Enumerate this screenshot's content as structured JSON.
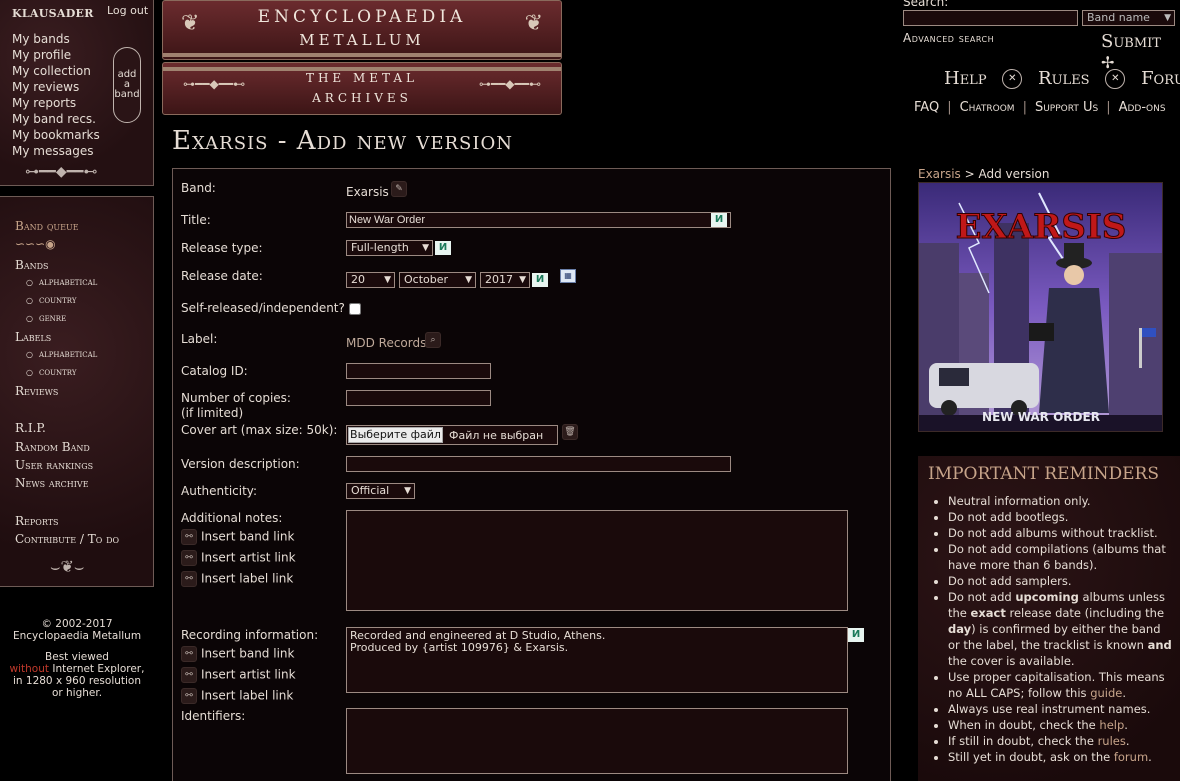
{
  "user": {
    "name": "KLAUSADER",
    "logout": "Log out"
  },
  "user_menu": [
    "My bands",
    "My profile",
    "My collection",
    "My reviews",
    "My reports",
    "My band recs.",
    "My bookmarks",
    "My messages"
  ],
  "add_band": {
    "l1": "add",
    "l2": "a",
    "l3": "band"
  },
  "nav": {
    "band_queue": "Band queue",
    "bands": "Bands",
    "bands_sub": [
      "alphabetical",
      "country",
      "genre"
    ],
    "labels": "Labels",
    "labels_sub": [
      "alphabetical",
      "country"
    ],
    "reviews": "Reviews",
    "rip": "R.I.P.",
    "random_band": "Random Band",
    "user_rankings": "User rankings",
    "news_archive": "News archive",
    "reports": "Reports",
    "contribute": "Contribute / To do"
  },
  "footer": {
    "copyright": "© 2002-2017",
    "site": "Encyclopaedia Metallum",
    "best1": "Best viewed",
    "without": "without",
    "best2": " Internet Explorer,",
    "best3": "in 1280 x 960 resolution",
    "best4": "or higher."
  },
  "logo": {
    "line1": "ENCYCLOPAEDIA",
    "line2": "METALLUM",
    "line3": "THE   METAL",
    "line4": "ARCHIVES"
  },
  "search": {
    "label": "Search:",
    "type": "Band name",
    "advanced": "Advanced search",
    "submit": "Submit"
  },
  "top_links": {
    "help": "Help",
    "rules": "Rules",
    "forum": "Forum",
    "faq": "FAQ",
    "chatroom": "Chatroom",
    "support": "Support Us",
    "addons": "Add-ons"
  },
  "page_title": "Exarsis - Add new version",
  "form": {
    "band_label": "Band:",
    "band_value": "Exarsis",
    "title_label": "Title:",
    "title_value": "New War Order",
    "type_label": "Release type:",
    "type_value": "Full-length",
    "date_label": "Release date:",
    "date_day": "20",
    "date_month": "October",
    "date_year": "2017",
    "self_label": "Self-released/independent?",
    "label_label": "Label:",
    "label_value": "MDD Records",
    "catalog_label": "Catalog ID:",
    "copies_label": "Number of copies:",
    "copies_sub": "(if limited)",
    "cover_label": "Cover art (max size: 50k):",
    "file_button": "Выберите файл",
    "file_status": "Файл не выбран",
    "version_label": "Version description:",
    "auth_label": "Authenticity:",
    "auth_value": "Official",
    "notes_label": "Additional notes:",
    "insert_band": "Insert band link",
    "insert_artist": "Insert artist link",
    "insert_label": "Insert label link",
    "recording_label": "Recording information:",
    "recording_value": "Recorded and engineered at D Studio, Athens.\nProduced by {artist 109976} & Exarsis.",
    "identifiers_label": "Identifiers:"
  },
  "crumb": {
    "band": "Exarsis",
    "sep": " > ",
    "page": "Add version"
  },
  "cover": {
    "logo_text": "EXARSIS",
    "title_text": "NEW WAR ORDER"
  },
  "reminders": {
    "heading": "IMPORTANT REMINDERS",
    "r1": "Neutral information only.",
    "r2": "Do not add bootlegs.",
    "r3": "Do not add albums without tracklist.",
    "r4": "Do not add compilations (albums that have more than 6 bands).",
    "r5": "Do not add samplers.",
    "r6a": "Do not add ",
    "r6b": "upcoming",
    "r6c": " albums unless the ",
    "r6d": "exact",
    "r6e": " release date (including the ",
    "r6f": "day",
    "r6g": ") is confirmed by either the band or the label, the tracklist is known ",
    "r6h": "and",
    "r6i": " the cover is available.",
    "r7a": "Use proper capitalisation. This means no ALL CAPS; follow this ",
    "r7b": "guide",
    "r7c": ".",
    "r8": "Always use real instrument names.",
    "r9a": "When in doubt, check the ",
    "r9b": "help",
    "r9c": ".",
    "r10a": "If still in doubt, check the ",
    "r10b": "rules",
    "r10c": ".",
    "r11a": "Still yet in doubt, ask on the ",
    "r11b": "forum",
    "r11c": "."
  },
  "colors": {
    "accent": "#c7a48a",
    "panel": "#2a1416",
    "border": "#6e5b56"
  }
}
